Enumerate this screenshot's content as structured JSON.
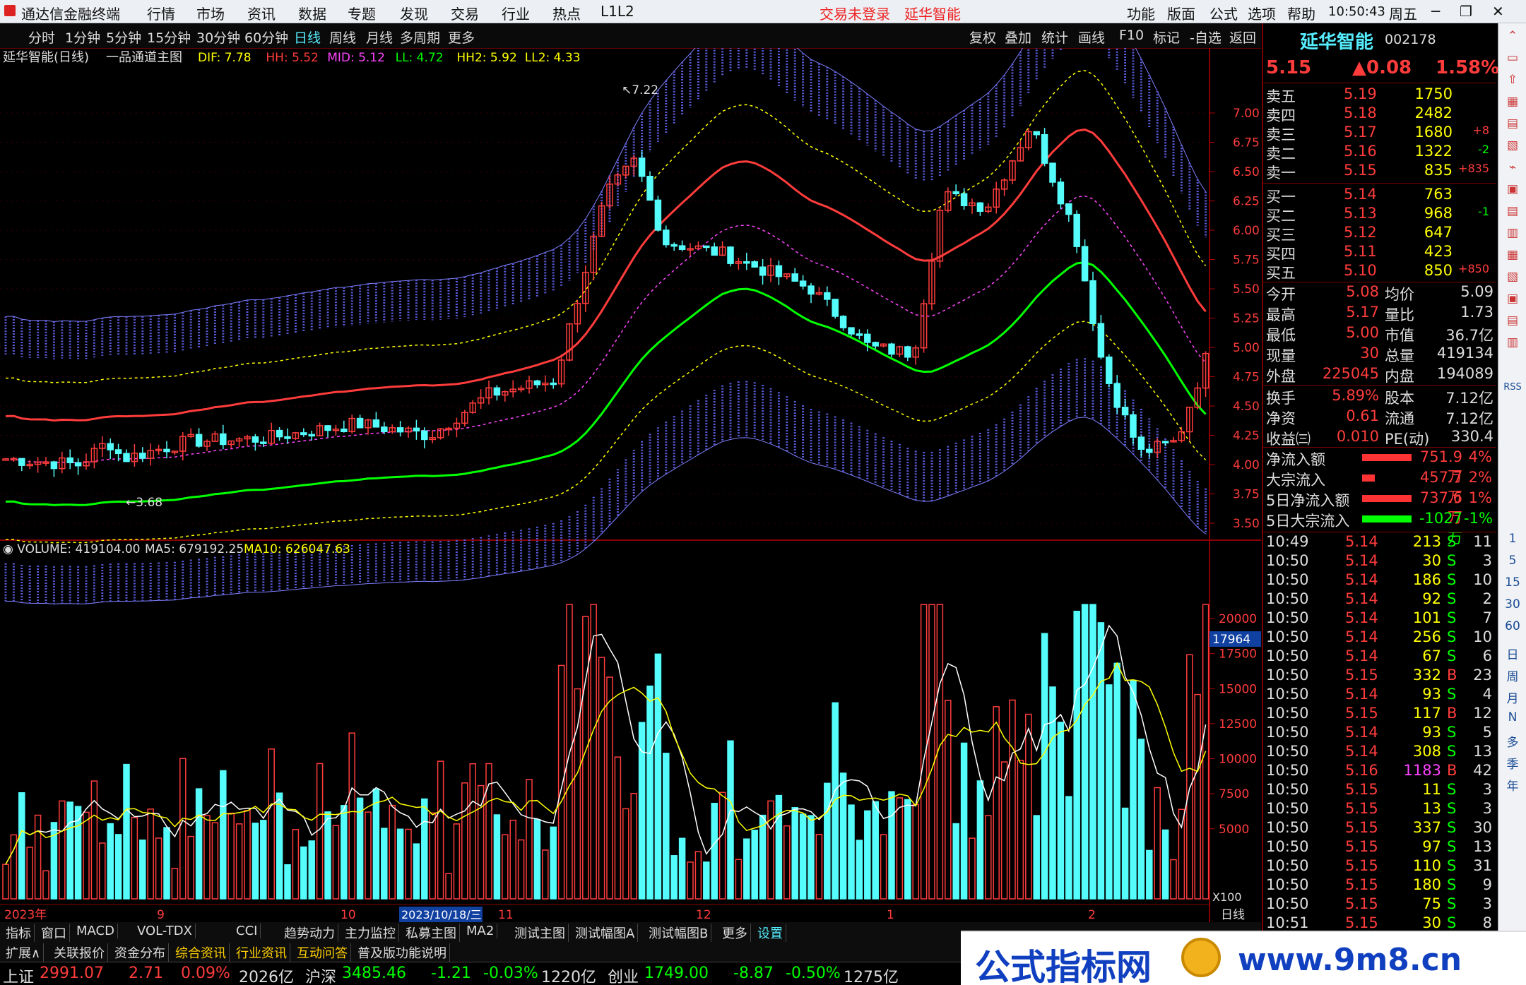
{
  "colors": {
    "up": "#ff3c3c",
    "down": "#54fcfc",
    "yellow": "#ffff00",
    "green": "#00ff00",
    "bg": "#000000"
  },
  "titlebar": {
    "app_title": "通达信金融终端",
    "menus": [
      "行情",
      "市场",
      "资讯",
      "数据",
      "专题",
      "发现",
      "交易",
      "行业",
      "热点",
      "L1L2"
    ],
    "trade_status": "交易未登录",
    "smart": "延华智能",
    "right_menus": [
      "功能",
      "版面",
      "公式",
      "选项",
      "帮助"
    ],
    "time": "10:50:43",
    "weekday": "周五"
  },
  "periods": [
    "分时",
    "1分钟",
    "5分钟",
    "15分钟",
    "30分钟",
    "60分钟",
    "日线",
    "周线",
    "月线",
    "多周期",
    "更多"
  ],
  "active_period": "日线",
  "toolbar": [
    "复权",
    "叠加",
    "统计",
    "画线",
    "F10",
    "标记",
    "-自选",
    "返回"
  ],
  "main_chart": {
    "stock": "延华智能(日线)",
    "indicator": "一品通道主图",
    "params": [
      {
        "k": "DIF: 7.78",
        "c": "#ffff00"
      },
      {
        "k": "HH: 5.52",
        "c": "#ff3c3c"
      },
      {
        "k": "MID: 5.12",
        "c": "#ff44ff"
      },
      {
        "k": "LL: 4.72",
        "c": "#00ff00"
      },
      {
        "k": "HH2: 5.92",
        "c": "#ffff00"
      },
      {
        "k": "LL2: 4.33",
        "c": "#ffff00"
      }
    ],
    "y_ticks": [
      "7.00",
      "6.75",
      "6.50",
      "6.25",
      "6.00",
      "5.75",
      "5.50",
      "5.25",
      "5.00",
      "4.75",
      "4.50",
      "4.25",
      "4.00",
      "3.75",
      "3.50"
    ],
    "max_label": "7.22",
    "min_label": "3.68"
  },
  "volume_chart": {
    "title": "VOLUME: 419104.00",
    "ma5": "MA5: 679192.25",
    "ma10": "MA10: 626047.63",
    "y_ticks": [
      "20000",
      "17500",
      "15000",
      "12500",
      "10000",
      "7500",
      "5000"
    ],
    "marker": "17964",
    "unit": "X100"
  },
  "x_axis": {
    "labels": [
      "2023年",
      "9",
      "10",
      "11",
      "12",
      "1",
      "2"
    ],
    "cursor": "2023/10/18/三",
    "mode": "日线"
  },
  "quote": {
    "name": "延华智能",
    "code": "002178",
    "price": "5.15",
    "change": "▲0.08",
    "pct": "1.58%",
    "asks": [
      [
        "卖五",
        "5.19",
        "1750",
        ""
      ],
      [
        "卖四",
        "5.18",
        "2482",
        ""
      ],
      [
        "卖三",
        "5.17",
        "1680",
        "+8"
      ],
      [
        "卖二",
        "5.16",
        "1322",
        "-2"
      ],
      [
        "卖一",
        "5.15",
        "835",
        "+835"
      ]
    ],
    "bids": [
      [
        "买一",
        "5.14",
        "763",
        ""
      ],
      [
        "买二",
        "5.13",
        "968",
        "-1"
      ],
      [
        "买三",
        "5.12",
        "647",
        ""
      ],
      [
        "买四",
        "5.11",
        "423",
        ""
      ],
      [
        "买五",
        "5.10",
        "850",
        "+850"
      ]
    ],
    "stats": [
      [
        "今开",
        "5.08",
        "均价",
        "5.09"
      ],
      [
        "最高",
        "5.17",
        "量比",
        "1.73"
      ],
      [
        "最低",
        "5.00",
        "市值",
        "36.7亿"
      ],
      [
        "现量",
        "30",
        "总量",
        "419134"
      ],
      [
        "外盘",
        "225045",
        "内盘",
        "194089"
      ]
    ],
    "stats2": [
      [
        "换手",
        "5.89%",
        "股本",
        "7.12亿"
      ],
      [
        "净资",
        "0.61",
        "流通",
        "7.12亿"
      ],
      [
        "收益㈢",
        "0.010",
        "PE(动)",
        "330.4"
      ]
    ],
    "flows": [
      [
        "净流入额",
        "751.9万",
        "4%"
      ],
      [
        "大宗流入",
        "457.7万",
        "2%"
      ],
      [
        "5日净流入额",
        "737.6万",
        "1%"
      ],
      [
        "5日大宗流入",
        "-1027万",
        "-1%"
      ]
    ],
    "ticks": [
      [
        "10:49",
        "5.14",
        "213",
        "S",
        "11"
      ],
      [
        "10:50",
        "5.14",
        "30",
        "S",
        "3"
      ],
      [
        "10:50",
        "5.14",
        "186",
        "S",
        "10"
      ],
      [
        "10:50",
        "5.14",
        "92",
        "S",
        "2"
      ],
      [
        "10:50",
        "5.14",
        "101",
        "S",
        "7"
      ],
      [
        "10:50",
        "5.14",
        "256",
        "S",
        "10"
      ],
      [
        "10:50",
        "5.14",
        "67",
        "S",
        "6"
      ],
      [
        "10:50",
        "5.15",
        "332",
        "B",
        "23"
      ],
      [
        "10:50",
        "5.14",
        "93",
        "S",
        "4"
      ],
      [
        "10:50",
        "5.15",
        "117",
        "B",
        "12"
      ],
      [
        "10:50",
        "5.14",
        "93",
        "S",
        "5"
      ],
      [
        "10:50",
        "5.14",
        "308",
        "S",
        "13"
      ],
      [
        "10:50",
        "5.16",
        "1183",
        "B",
        "42"
      ],
      [
        "10:50",
        "5.15",
        "11",
        "S",
        "3"
      ],
      [
        "10:50",
        "5.15",
        "13",
        "S",
        "3"
      ],
      [
        "10:50",
        "5.15",
        "337",
        "S",
        "30"
      ],
      [
        "10:50",
        "5.15",
        "97",
        "S",
        "13"
      ],
      [
        "10:50",
        "5.15",
        "110",
        "S",
        "31"
      ],
      [
        "10:50",
        "5.15",
        "180",
        "S",
        "9"
      ],
      [
        "10:50",
        "5.15",
        "75",
        "S",
        "3"
      ],
      [
        "10:51",
        "5.15",
        "30",
        "S",
        "8"
      ]
    ]
  },
  "sidebar": [
    "日",
    "周",
    "月",
    "N",
    "多",
    "季",
    "年"
  ],
  "sidebar_top": [
    "1",
    "5",
    "15",
    "30",
    "60"
  ],
  "tabs1": [
    "指标",
    "窗口",
    "MACD",
    "VOL-TDX",
    "CCI",
    "趋势动力",
    "主力监控",
    "私募主图",
    "MA2",
    "测试主图",
    "测试幅图A",
    "测试幅图B",
    "更多",
    "设置"
  ],
  "tabs2": [
    "扩展∧",
    "关联报价",
    "资金分布",
    "综合资讯",
    "行业资讯",
    "互动问答",
    "普及版功能说明"
  ],
  "status": [
    {
      "n": "上证",
      "v": "2991.07",
      "c": "2.71",
      "p": "0.09%",
      "a": "2026亿"
    },
    {
      "n": "沪深",
      "v": "3485.46",
      "c": "-1.21",
      "p": "-0.03%",
      "a": "1220亿"
    },
    {
      "n": "创业",
      "v": "1749.00",
      "c": "-8.87",
      "p": "-0.50%",
      "a": "1275亿"
    }
  ],
  "banner": {
    "text": "公式指标网",
    "url": "www.9m8.cn"
  }
}
